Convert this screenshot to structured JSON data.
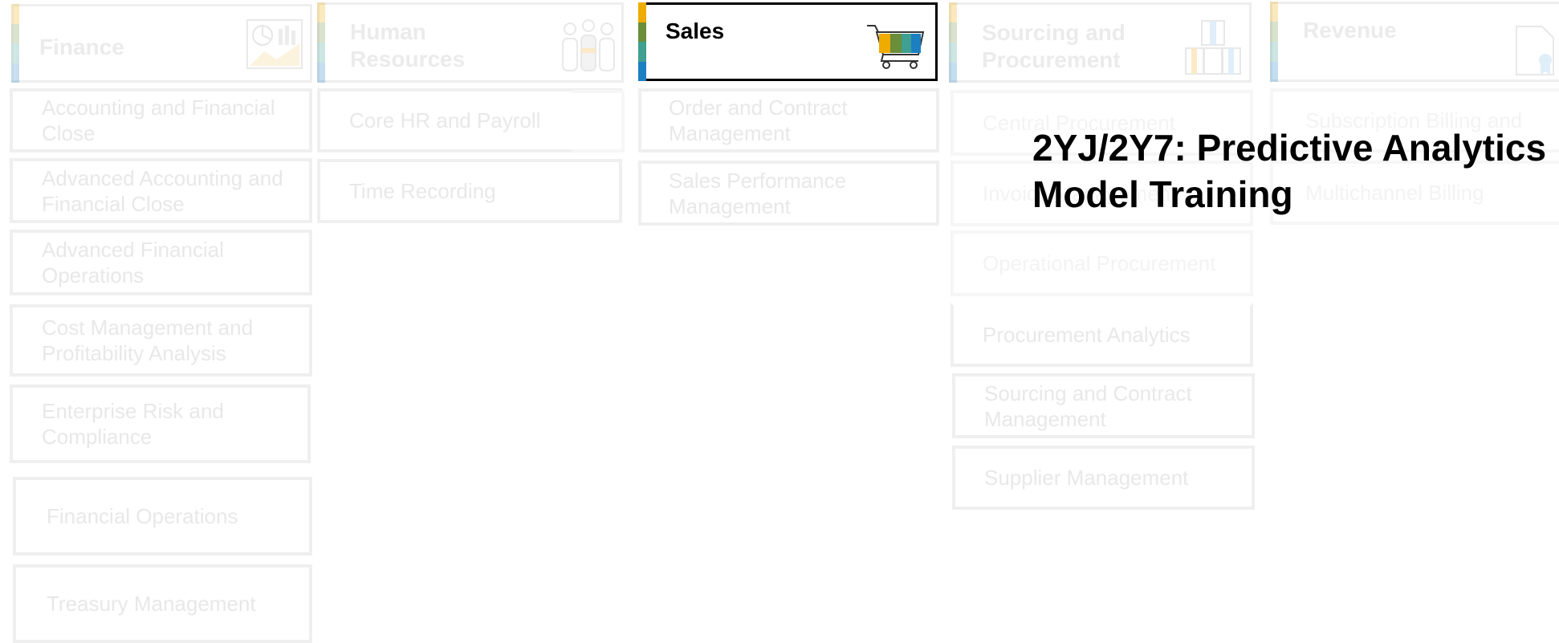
{
  "categories": [
    {
      "id": "finance",
      "title": "Finance",
      "active": false,
      "icon": "pie-chart-icon",
      "items": [
        "Accounting and Financial Close",
        "Advanced Accounting and Financial Close",
        "Advanced Financial Operations",
        "Cost Management and Profitability Analysis",
        "Enterprise Risk and Compliance",
        "Financial Operations",
        "Treasury  Management"
      ]
    },
    {
      "id": "human-resources",
      "title": "Human Resources",
      "active": false,
      "icon": "people-icon",
      "items": [
        "Core HR and Payroll",
        "Time Recording"
      ]
    },
    {
      "id": "sales",
      "title": "Sales",
      "active": true,
      "icon": "shopping-cart-icon",
      "items": [
        "Order and Contract Management",
        "Sales Performance Management"
      ]
    },
    {
      "id": "sourcing-procurement",
      "title": "Sourcing and Procurement",
      "active": false,
      "icon": "boxes-icon",
      "items": [
        "Central Procurement",
        "Invoice Management",
        "Operational Procurement",
        "Procurement Analytics",
        "Sourcing and Contract Management",
        "Supplier Management"
      ]
    },
    {
      "id": "revenue",
      "title": "Revenue",
      "active": false,
      "icon": "document-ribbon-icon",
      "items": [
        "Subscription Billing and",
        "Multichannel Billing"
      ]
    }
  ],
  "overlay": {
    "line1": "2YJ/2Y7: Predictive Analytics",
    "line2": "Model Training"
  },
  "colors": {
    "accent_orange": "#f0ab00",
    "accent_green": "#6b8e3a",
    "accent_teal": "#3f9f91",
    "accent_blue": "#1c7fc1",
    "border_inactive": "#eeeeee",
    "text_faded": "#e8e8e8",
    "active_border": "#000000"
  }
}
